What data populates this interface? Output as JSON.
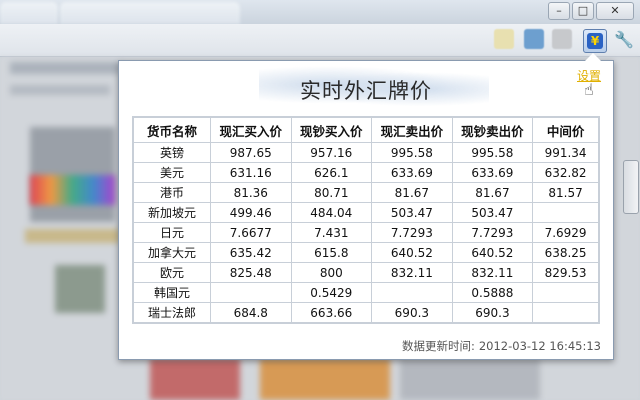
{
  "popup": {
    "title": "实时外汇牌价",
    "settings_label": "设置",
    "footer_label": "数据更新时间:",
    "footer_time": "2012-03-12 16:45:13"
  },
  "table": {
    "headers": [
      "货币名称",
      "现汇买入价",
      "现钞买入价",
      "现汇卖出价",
      "现钞卖出价",
      "中间价"
    ],
    "rows": [
      [
        "英镑",
        "987.65",
        "957.16",
        "995.58",
        "995.58",
        "991.34"
      ],
      [
        "美元",
        "631.16",
        "626.1",
        "633.69",
        "633.69",
        "632.82"
      ],
      [
        "港币",
        "81.36",
        "80.71",
        "81.67",
        "81.67",
        "81.57"
      ],
      [
        "新加坡元",
        "499.46",
        "484.04",
        "503.47",
        "503.47",
        ""
      ],
      [
        "日元",
        "7.6677",
        "7.431",
        "7.7293",
        "7.7293",
        "7.6929"
      ],
      [
        "加拿大元",
        "635.42",
        "615.8",
        "640.52",
        "640.52",
        "638.25"
      ],
      [
        "欧元",
        "825.48",
        "800",
        "832.11",
        "832.11",
        "829.53"
      ],
      [
        "韩国元",
        "",
        "0.5429",
        "",
        "0.5888",
        ""
      ],
      [
        "瑞士法郎",
        "684.8",
        "663.66",
        "690.3",
        "690.3",
        ""
      ]
    ]
  },
  "browser": {
    "minimize_glyph": "–",
    "maximize_glyph": "□",
    "close_glyph": "✕",
    "extension_icon": "forex-extension-icon",
    "extension_glyph": "¥",
    "wrench_glyph": "🔧",
    "hand_glyph": "☝"
  },
  "colors": {
    "settings_link": "#e0b000",
    "table_border": "#c8cfd8",
    "extension_blue": "#2a62c4"
  }
}
